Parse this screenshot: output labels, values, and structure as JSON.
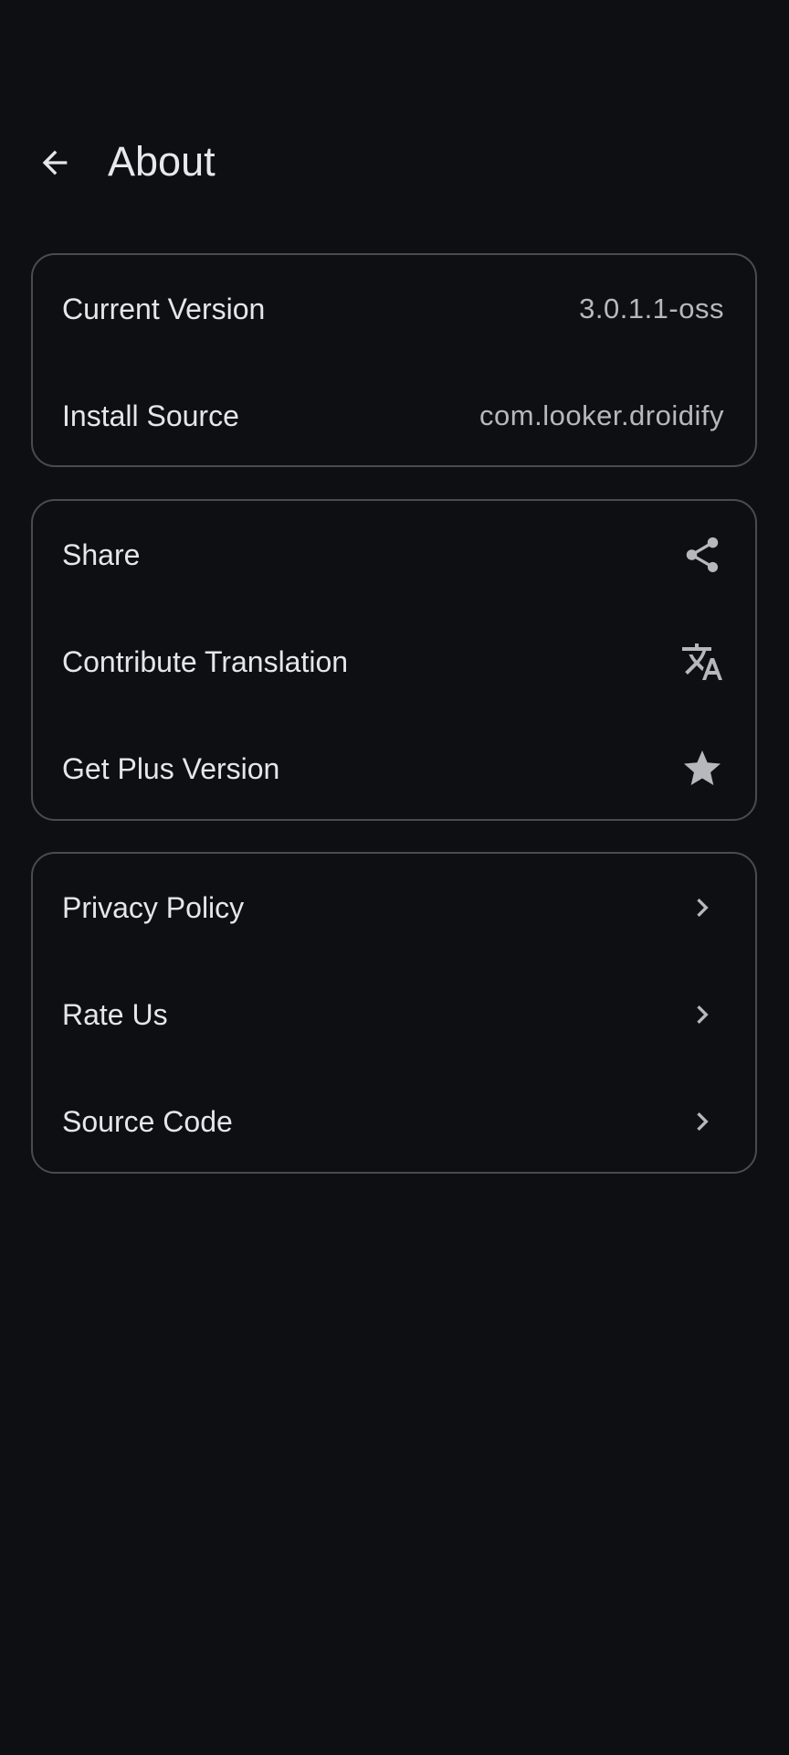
{
  "header": {
    "title": "About",
    "back_icon": "arrow-back-icon"
  },
  "info_card": {
    "items": [
      {
        "label": "Current Version",
        "value": "3.0.1.1-oss"
      },
      {
        "label": "Install Source",
        "value": "com.looker.droidify"
      }
    ]
  },
  "actions_card": {
    "items": [
      {
        "label": "Share",
        "icon": "share-icon"
      },
      {
        "label": "Contribute Translation",
        "icon": "translate-icon"
      },
      {
        "label": "Get Plus Version",
        "icon": "star-icon"
      }
    ]
  },
  "links_card": {
    "items": [
      {
        "label": "Privacy Policy",
        "icon": "chevron-right-icon"
      },
      {
        "label": "Rate Us",
        "icon": "chevron-right-icon"
      },
      {
        "label": "Source Code",
        "icon": "chevron-right-icon"
      }
    ]
  },
  "colors": {
    "background": "#0e0f13",
    "card_border": "#4a4b52",
    "text_primary": "#e6e6ea",
    "text_secondary": "#b7b8be",
    "icon": "#b7b8be"
  }
}
